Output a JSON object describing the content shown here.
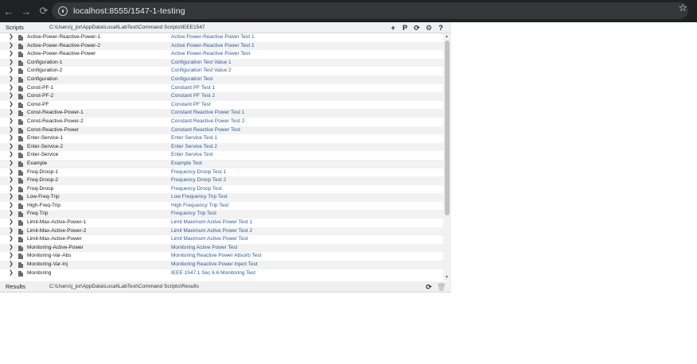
{
  "browser": {
    "url": "localhost:8555/1547-1-testing",
    "back_icon": "←",
    "forward_icon": "→",
    "reload_icon": "⟳",
    "star_icon": "☆"
  },
  "scripts_panel": {
    "title": "Scripts",
    "path": "C:\\Users\\j_jor\\AppData\\Local\\LabTest\\Command Scripts\\IEEE1547",
    "tools": {
      "add": "+",
      "p": "P",
      "refresh": "⟳",
      "settings": "⚙",
      "help": "?"
    }
  },
  "scripts": [
    {
      "name": "Active-Power-Reactive-Power-1",
      "desc": "Active Power-Reactive Power Test 1"
    },
    {
      "name": "Active-Power-Reactive-Power-2",
      "desc": "Active Power-Reactive Power Test 2"
    },
    {
      "name": "Active-Power-Reactive-Power",
      "desc": "Active Power-Reactive Power Test"
    },
    {
      "name": "Configuration-1",
      "desc": "Configuration Test Value 1"
    },
    {
      "name": "Configuration-2",
      "desc": "Configuration Test Value 2"
    },
    {
      "name": "Configuration",
      "desc": "Configuration Test"
    },
    {
      "name": "Const-PF-1",
      "desc": "Constant PF Test 1"
    },
    {
      "name": "Const-PF-2",
      "desc": "Constant PF Test 2"
    },
    {
      "name": "Const-PF",
      "desc": "Constant PF Test"
    },
    {
      "name": "Const-Reactive-Power-1",
      "desc": "Constant Reactive Power Test 1"
    },
    {
      "name": "Const-Reactive-Power-2",
      "desc": "Constant Reactive Power Test 2"
    },
    {
      "name": "Const-Reactive-Power",
      "desc": "Constant Reactive Power Test"
    },
    {
      "name": "Enter-Service-1",
      "desc": "Enter Service Test 1"
    },
    {
      "name": "Enter-Service-2",
      "desc": "Enter Service Test 2"
    },
    {
      "name": "Enter-Service",
      "desc": "Enter Service Test"
    },
    {
      "name": "Example",
      "desc": "Example Test"
    },
    {
      "name": "Freq-Droop-1",
      "desc": "Frequency Droop Test 1"
    },
    {
      "name": "Freq-Droop-2",
      "desc": "Frequency Droop Test 2"
    },
    {
      "name": "Freq-Droop",
      "desc": "Frequency Droop Test"
    },
    {
      "name": "Low-Freq-Trip",
      "desc": "Low Frequency Trip Test"
    },
    {
      "name": "High-Freq-Trip",
      "desc": "High Frequency Trip Test"
    },
    {
      "name": "Freq-Trip",
      "desc": "Frequency Trip Test"
    },
    {
      "name": "Limit-Max-Active-Power-1",
      "desc": "Limit Maximum Active Power Test 1"
    },
    {
      "name": "Limit-Max-Active-Power-2",
      "desc": "Limit Maximum Active Power Test 2"
    },
    {
      "name": "Limit-Max-Active-Power",
      "desc": "Limit Maximum Active Power Test"
    },
    {
      "name": "Monitoring-Active-Power",
      "desc": "Monitoring Active Power Test"
    },
    {
      "name": "Monitoring-Var-Abs",
      "desc": "Monitoring Reactive Power Absorb Test"
    },
    {
      "name": "Monitoring-Var-Inj",
      "desc": "Monitoring Reactive Power Inject Test"
    },
    {
      "name": "Monitoring",
      "desc": "IEEE 1547.1 Sec 6.6 Monitoring Test"
    }
  ],
  "results_panel": {
    "title": "Results",
    "path": "C:\\Users\\j_jor\\AppData\\Local\\LabTest\\Command Scripts\\Results",
    "tools": {
      "refresh": "⟳",
      "delete": "🗑"
    }
  },
  "colors": {
    "link": "#2b5f9e",
    "browser_bar": "#202124"
  }
}
